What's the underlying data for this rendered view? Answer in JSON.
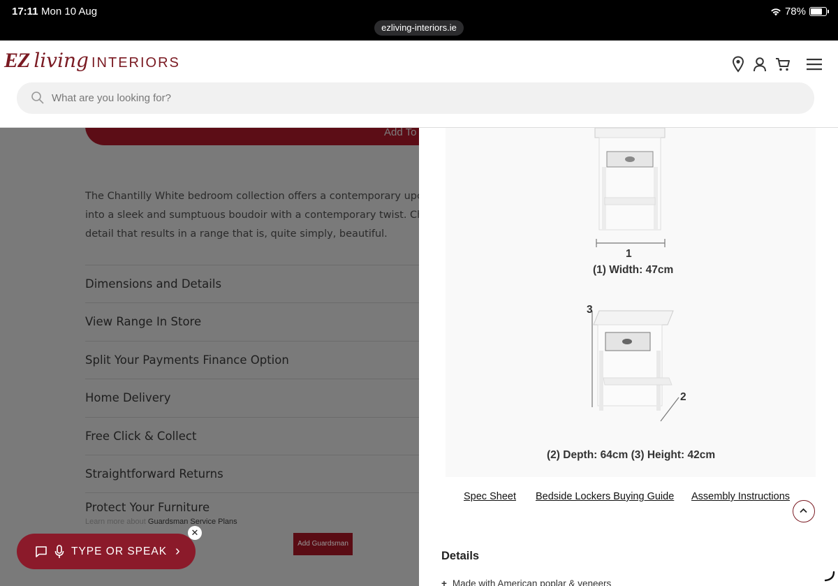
{
  "status_bar": {
    "time": "17:11",
    "date": "Mon 10 Aug",
    "battery": "78%",
    "battery_level": 0.78,
    "url": "ezliving-interiors.ie"
  },
  "header": {
    "logo_ez": "EZ",
    "logo_living": "living",
    "logo_interiors": "INTERIORS",
    "search_placeholder": "What are you looking for?",
    "icons": [
      "location-icon",
      "account-icon",
      "cart-icon",
      "menu-icon"
    ]
  },
  "left_page": {
    "cart_button_partial": "Add To",
    "description_lines": [
      "The Chantilly White bedroom collection offers a contemporary upc",
      "into a sleek and sumptuous boudoir with a contemporary twist. Cha",
      "detail that results in a range that is, quite simply, beautiful."
    ],
    "accordion": [
      "Dimensions and Details",
      "View Range In Store",
      "Split Your Payments Finance Option",
      "Home Delivery",
      "Free Click & Collect",
      "Straightforward Returns"
    ],
    "protect_title": "Protect Your Furniture",
    "protect_sub_prefix": "Learn more about ",
    "protect_sub_link": "Guardsman Service Plans",
    "guardsman_button": "Add Guardsman",
    "voice_label": "TYPE OR SPEAK",
    "voice_close": "✕",
    "voice_chevron": "›"
  },
  "panel": {
    "dim_1_marker": "1",
    "dim_width": "(1) Width: 47cm",
    "dim_3_marker": "3",
    "dim_2_marker": "2",
    "dim_depth_height": "(2) Depth: 64cm (3) Height: 42cm",
    "links": [
      "Spec Sheet",
      "Bedside Lockers Buying Guide",
      "Assembly Instructions"
    ],
    "details_title": "Details",
    "details_first": "Made with American poplar & veneers"
  },
  "colors": {
    "brand": "#7a1a22",
    "voice_button": "#8b1a2a",
    "overlay": "#7a7a7a"
  }
}
